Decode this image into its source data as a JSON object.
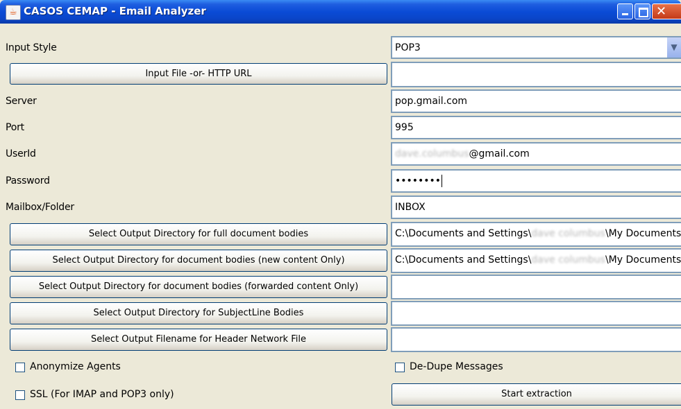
{
  "window": {
    "title": "CASOS CEMAP - Email Analyzer",
    "app_icon": "java-cup-icon"
  },
  "input_style": {
    "label": "Input Style",
    "value": "POP3"
  },
  "input_file_button": {
    "label": "Input File -or- HTTP URL",
    "value": ""
  },
  "server": {
    "label": "Server",
    "value": "pop.gmail.com"
  },
  "port": {
    "label": "Port",
    "value": "995"
  },
  "userid": {
    "label": "UserId",
    "value_blurred": "dave.columbus",
    "value_suffix": "@gmail.com"
  },
  "password": {
    "label": "Password",
    "value": "••••••••"
  },
  "mailbox": {
    "label": "Mailbox/Folder",
    "value": "INBOX"
  },
  "output_full": {
    "label": "Select Output Directory for full document bodies",
    "path_prefix": "C:\\Documents and Settings\\",
    "path_blurred": "dave columbus",
    "path_suffix": "\\My Documents"
  },
  "output_new": {
    "label": "Select Output Directory for document bodies (new content Only)",
    "path_prefix": "C:\\Documents and Settings\\",
    "path_blurred": "dave columbus",
    "path_suffix": "\\My Documents"
  },
  "output_forwarded": {
    "label": "Select Output Directory for document bodies (forwarded content Only)",
    "value": ""
  },
  "output_subject": {
    "label": "Select Output Directory for SubjectLine Bodies",
    "value": ""
  },
  "output_header": {
    "label": "Select Output Filename for Header Network File",
    "value": ""
  },
  "options": {
    "anonymize_label": "Anonymize Agents",
    "anonymize_checked": false,
    "dedupe_label": "De-Dupe Messages",
    "dedupe_checked": false,
    "ssl_label": "SSL (For IMAP and POP3 only)",
    "ssl_checked": false
  },
  "start_button": {
    "label": "Start extraction"
  }
}
